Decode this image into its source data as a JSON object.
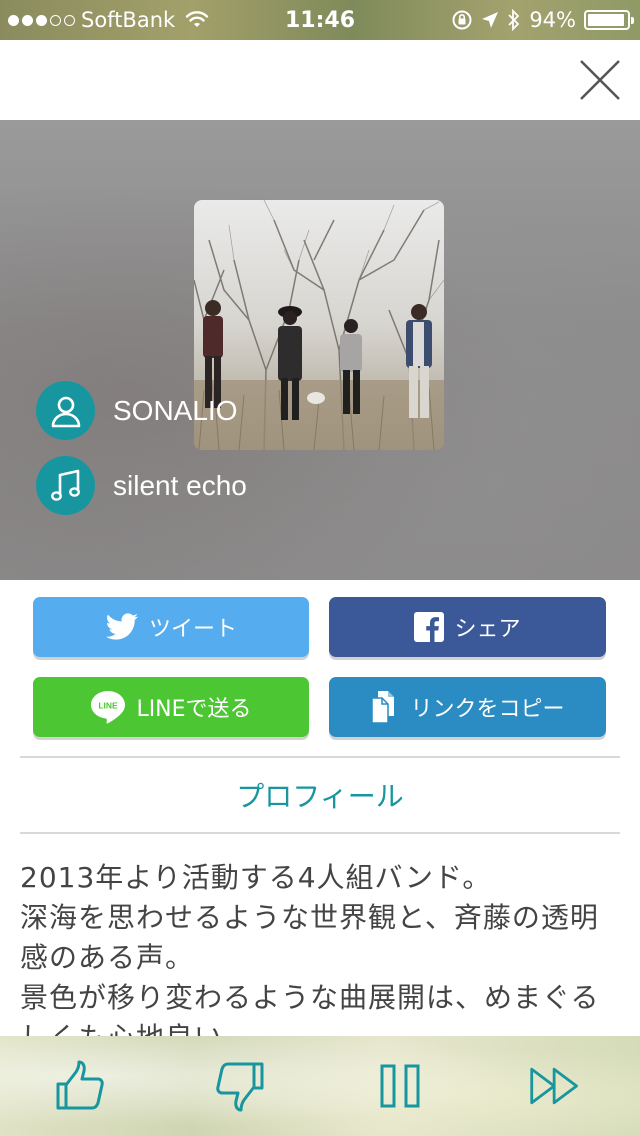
{
  "status_bar": {
    "carrier": "SoftBank",
    "time": "11:46",
    "battery": "94%",
    "battery_level": 0.94,
    "signal_bars_filled": 3,
    "signal_bars_total": 5
  },
  "track": {
    "artist": "SONALIO",
    "title": "silent echo",
    "artist_icon": "person-icon",
    "title_icon": "music-note-icon"
  },
  "share": {
    "tweet_label": "ツイート",
    "facebook_label": "シェア",
    "line_label": "LINEで送る",
    "copy_label": "リンクをコピー",
    "line_badge": "LINE"
  },
  "profile": {
    "heading": "プロフィール",
    "lines": [
      "2013年より活動する4人組バンド。",
      "深海を思わせるような世界観と、斉藤の透明",
      "感のある声。",
      "景色が移り変わるような曲展開は、めまぐる",
      "しくも心地良い。"
    ]
  },
  "colors": {
    "accent": "#1796a0",
    "twitter": "#55acee",
    "facebook": "#3b5998",
    "line": "#4cc632",
    "copy": "#2a8cc2"
  },
  "player": {
    "icons": [
      "thumbs-up-icon",
      "thumbs-down-icon",
      "pause-icon",
      "skip-forward-icon"
    ]
  }
}
